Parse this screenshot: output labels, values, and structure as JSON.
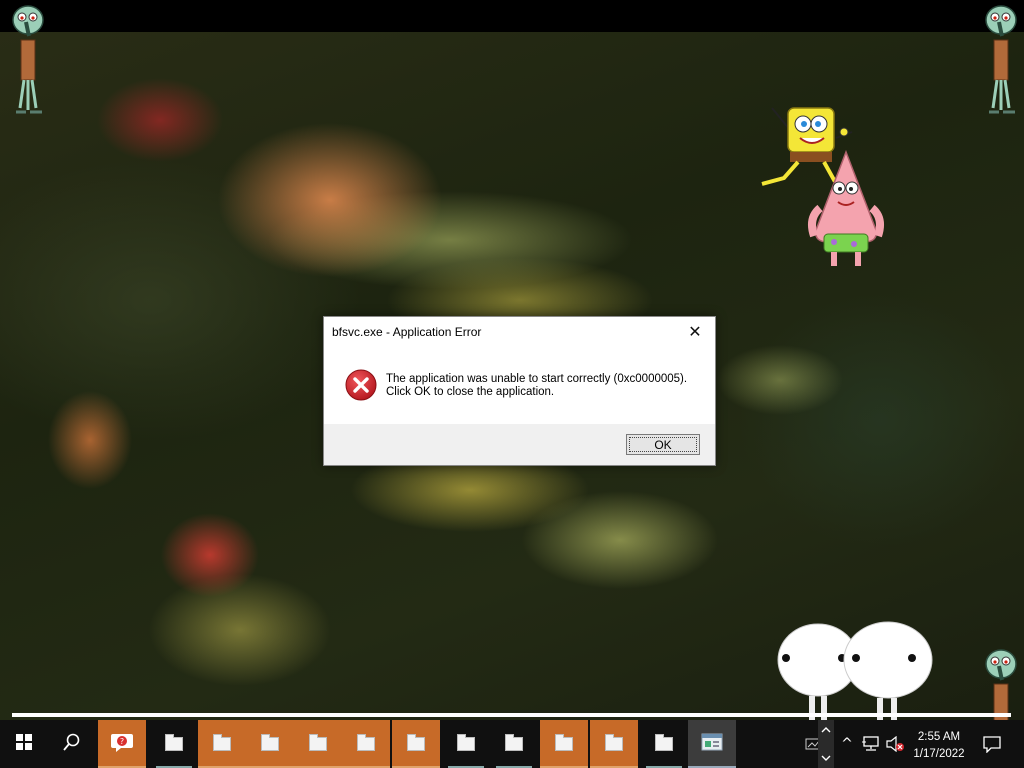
{
  "dialog": {
    "title": "bfsvc.exe - Application Error",
    "close_glyph": "✕",
    "icon": "error-icon",
    "message_line1": "The application was unable to start correctly (0xc0000005).",
    "message_line2": "Click OK to close the application.",
    "ok_label": "OK"
  },
  "taskbar": {
    "start_icon": "windows-logo-icon",
    "search_icon": "search-icon",
    "pinned_icon": "help-chat-icon",
    "apps": [
      {
        "icon": "folder-icon",
        "state": "dark"
      },
      {
        "icon": "folder-icon",
        "state": "highlight"
      },
      {
        "icon": "folder-icon",
        "state": "highlight"
      },
      {
        "icon": "folder-icon",
        "state": "highlight"
      },
      {
        "icon": "folder-icon",
        "state": "highlight"
      },
      {
        "icon": "folder-icon",
        "state": "highlight"
      },
      {
        "icon": "folder-icon",
        "state": "dark"
      },
      {
        "icon": "folder-icon",
        "state": "dark"
      },
      {
        "icon": "folder-icon",
        "state": "highlight"
      },
      {
        "icon": "folder-icon",
        "state": "highlight"
      },
      {
        "icon": "folder-icon",
        "state": "dark"
      },
      {
        "icon": "window-icon",
        "state": "active"
      }
    ],
    "tray": {
      "show_hidden_glyph": "^",
      "time": "2:55 AM",
      "date": "1/17/2022",
      "notification_icon": "action-center-icon"
    }
  },
  "colors": {
    "taskbar_bg": "#101010",
    "app_highlight": "#c76a28",
    "error_red": "#d3272e"
  }
}
